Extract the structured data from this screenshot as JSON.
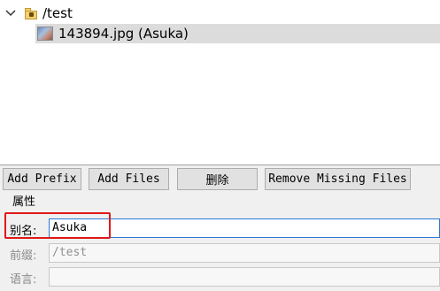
{
  "tree": {
    "root": {
      "label": "/test",
      "icon": "locked-folder-icon",
      "expanded": true
    },
    "children": [
      {
        "label": "143894.jpg (Asuka)",
        "icon": "image-thumbnail-icon",
        "selected": true
      }
    ]
  },
  "toolbar": {
    "add_prefix_label": "Add Prefix",
    "add_files_label": "Add Files",
    "delete_label": "删除",
    "remove_missing_label": "Remove Missing Files"
  },
  "properties": {
    "title": "属性",
    "alias": {
      "label": "别名:",
      "value": "Asuka"
    },
    "prefix": {
      "label": "前缀:",
      "value": "/test"
    },
    "language": {
      "label": "语言:",
      "value": ""
    }
  },
  "colors": {
    "highlight": "#e01818",
    "selection": "#dcdcdc",
    "focus_border": "#2a78d7"
  }
}
